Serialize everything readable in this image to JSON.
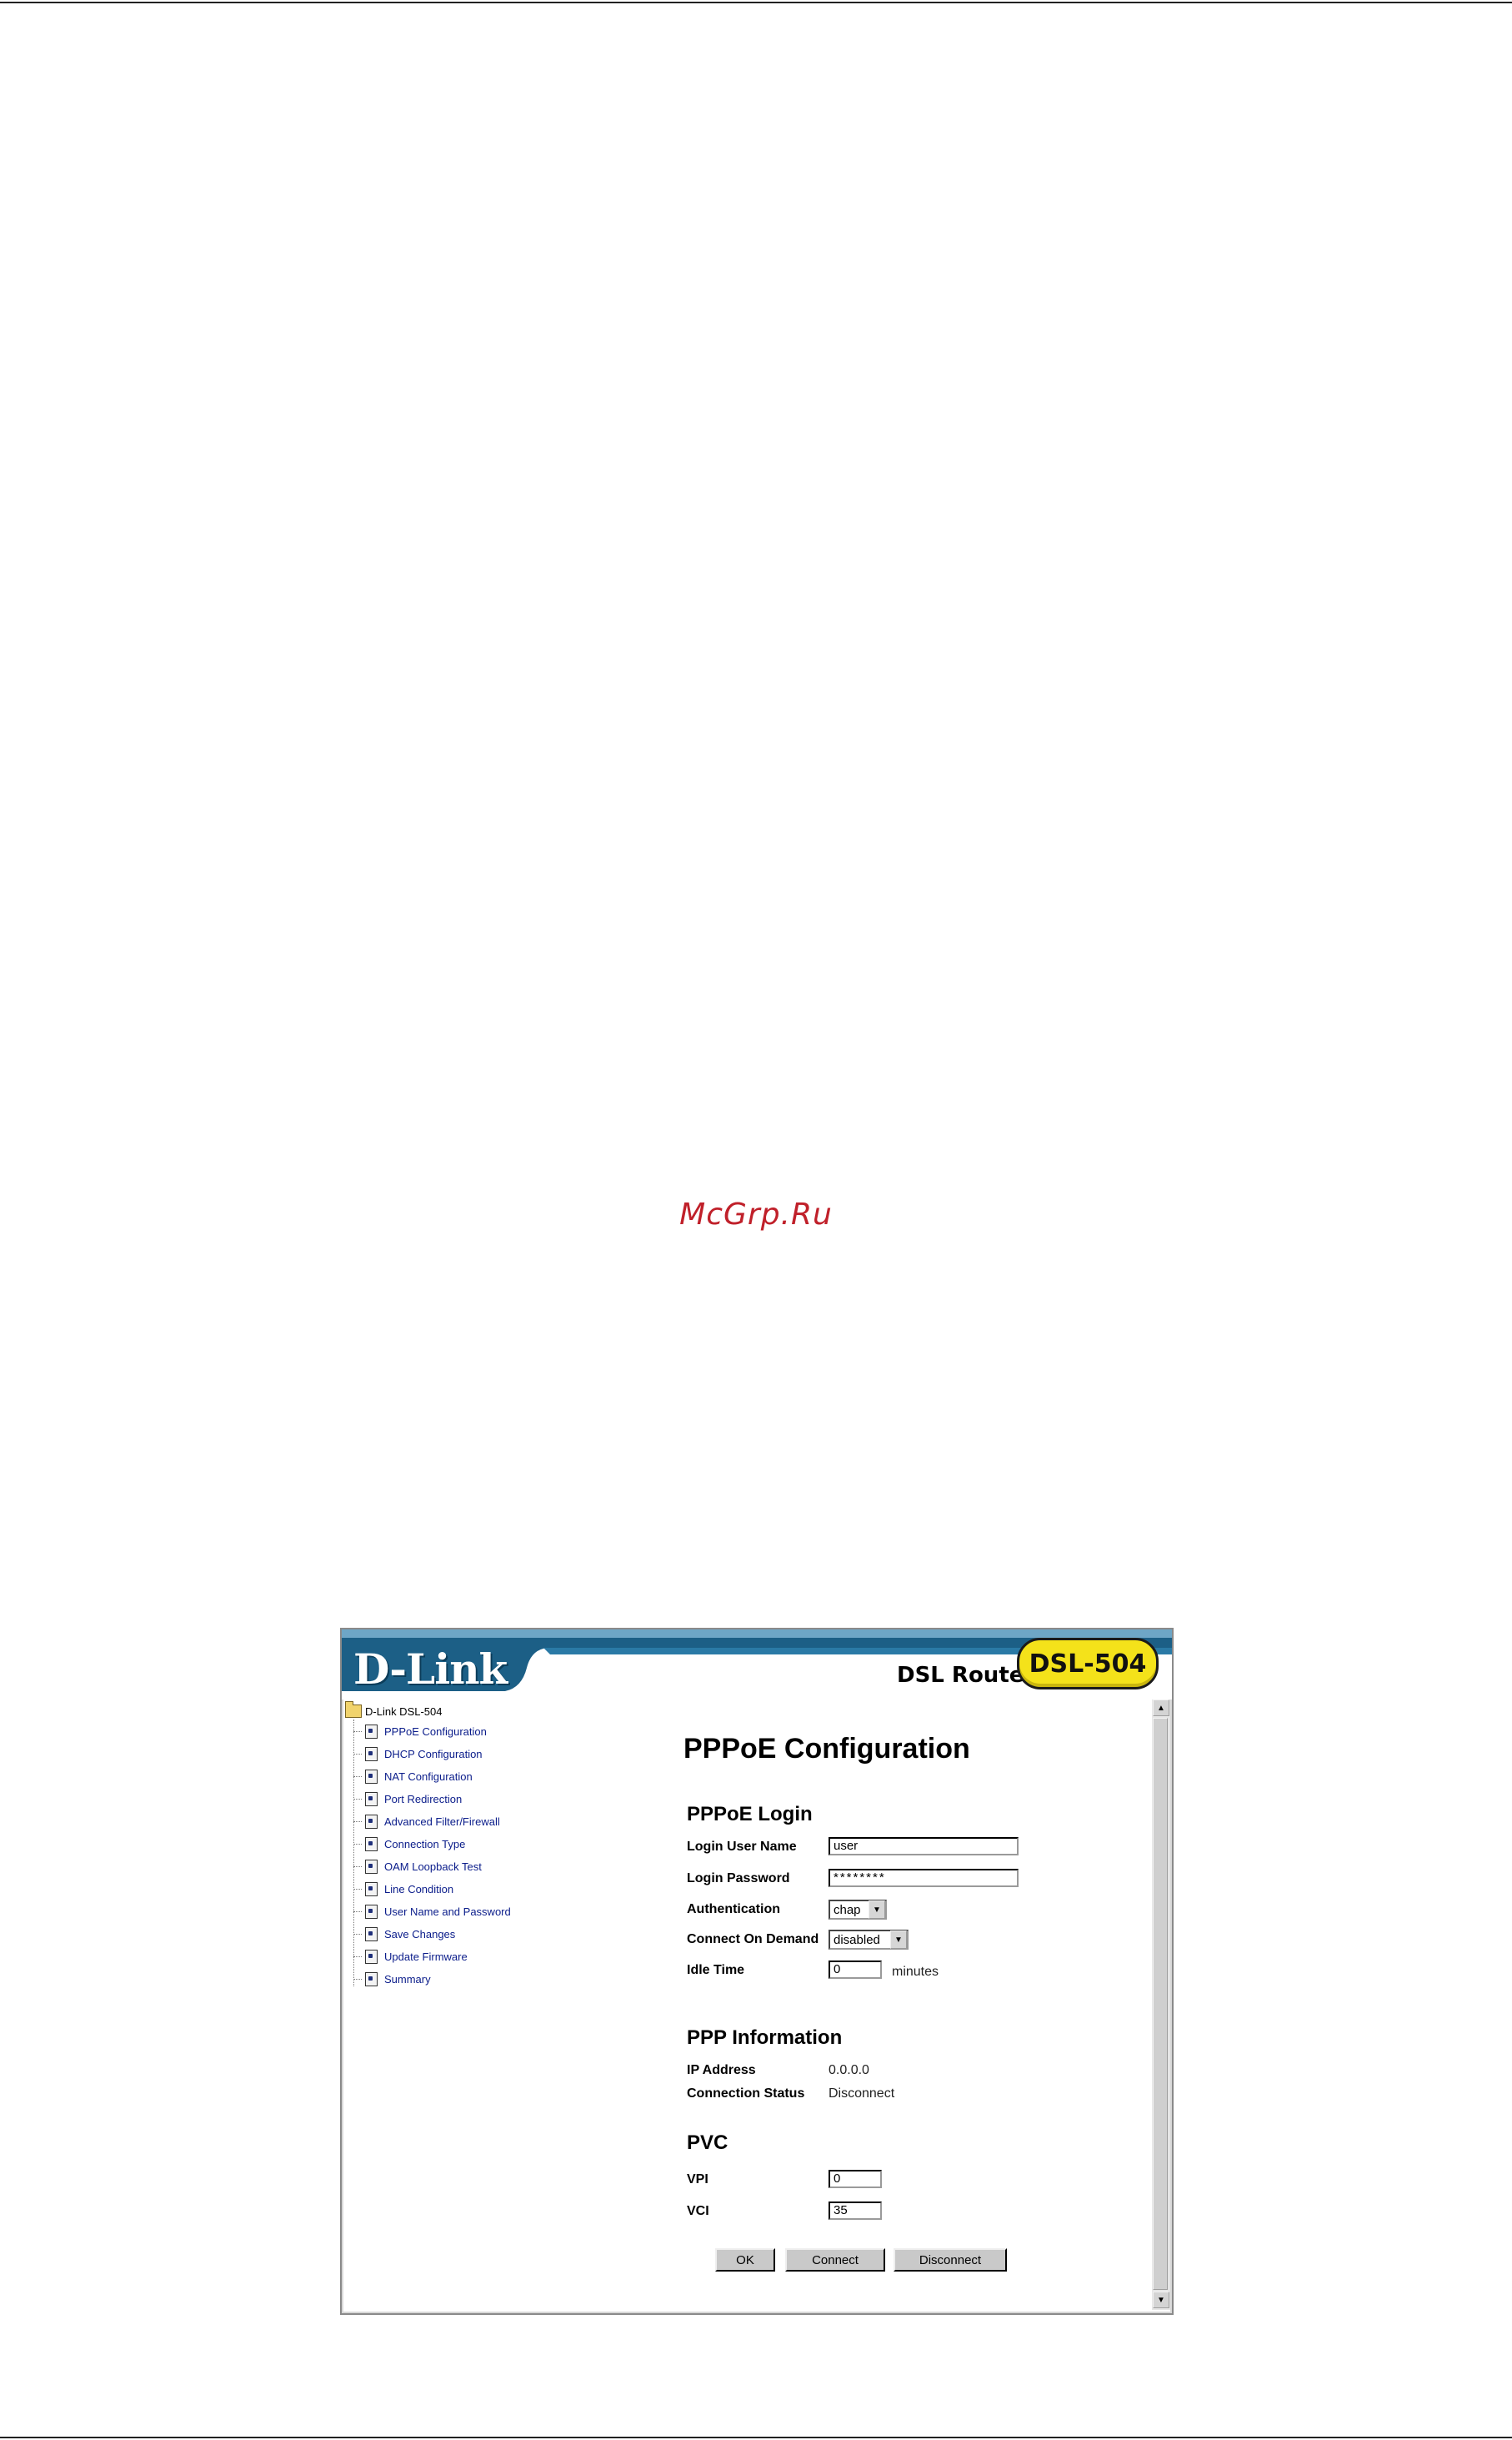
{
  "watermark": "McGrp.Ru",
  "header": {
    "logo_text": "D-Link",
    "product_type": "DSL Router",
    "model": "DSL-504"
  },
  "sidebar": {
    "root": "D-Link DSL-504",
    "items": [
      {
        "label": "PPPoE Configuration"
      },
      {
        "label": "DHCP Configuration"
      },
      {
        "label": "NAT Configuration"
      },
      {
        "label": "Port Redirection"
      },
      {
        "label": "Advanced Filter/Firewall"
      },
      {
        "label": "Connection Type"
      },
      {
        "label": "OAM Loopback Test"
      },
      {
        "label": "Line Condition"
      },
      {
        "label": "User Name and Password"
      },
      {
        "label": "Save Changes"
      },
      {
        "label": "Update Firmware"
      },
      {
        "label": "Summary"
      }
    ]
  },
  "main": {
    "title": "PPPoE Configuration",
    "login": {
      "heading": "PPPoE Login",
      "user_name_label": "Login User Name",
      "user_name_value": "user",
      "password_label": "Login Password",
      "password_value": "********",
      "auth_label": "Authentication",
      "auth_value": "chap",
      "on_demand_label": "Connect On Demand",
      "on_demand_value": "disabled",
      "idle_label": "Idle Time",
      "idle_value": "0",
      "idle_suffix": "minutes"
    },
    "info": {
      "heading": "PPP Information",
      "ip_label": "IP Address",
      "ip_value": "0.0.0.0",
      "status_label": "Connection Status",
      "status_value": "Disconnect"
    },
    "pvc": {
      "heading": "PVC",
      "vpi_label": "VPI",
      "vpi_value": "0",
      "vci_label": "VCI",
      "vci_value": "35"
    },
    "buttons": {
      "ok": "OK",
      "connect": "Connect",
      "disconnect": "Disconnect"
    }
  },
  "colors": {
    "header_blue": "#1c5f86",
    "header_band": "#2a7aa6",
    "badge_yellow": "#f4e21a",
    "link_blue": "#0a1c8a",
    "watermark_red": "#c0202a"
  }
}
